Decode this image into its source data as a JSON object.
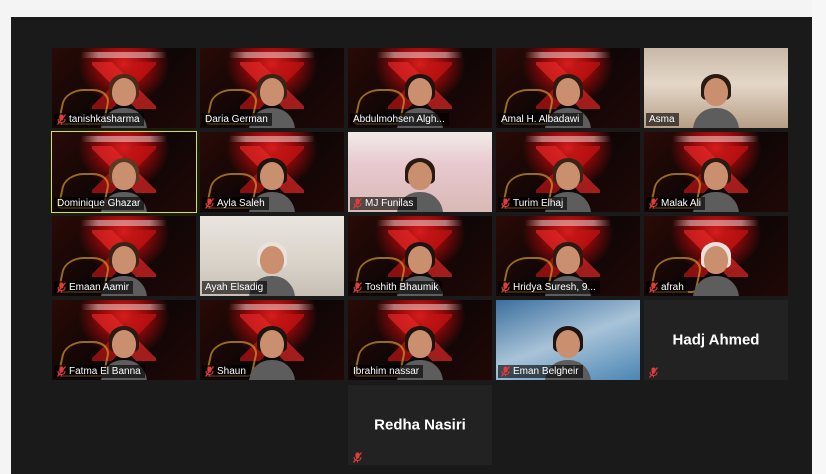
{
  "colors": {
    "active_border": "#cfe34a",
    "muted_mic": "#e23b3b",
    "background": "#1a1a1a"
  },
  "icons": {
    "muted": "mic-muted-icon"
  },
  "participants": [
    {
      "name": "tanishkasharma",
      "muted": true
    },
    {
      "name": "Daria German",
      "muted": false
    },
    {
      "name": "Abdulmohsen Algh...",
      "muted": false
    },
    {
      "name": "Amal H. Albadawi",
      "muted": false
    },
    {
      "name": "Asma",
      "muted": false
    },
    {
      "name": "Dominique Ghazar",
      "muted": false,
      "active_speaker": true
    },
    {
      "name": "Ayla Saleh",
      "muted": true
    },
    {
      "name": "MJ Funilas",
      "muted": true
    },
    {
      "name": "Turim Elhaj",
      "muted": true
    },
    {
      "name": "Malak Ali",
      "muted": true
    },
    {
      "name": "Emaan Aamir",
      "muted": true
    },
    {
      "name": "Ayah Elsadig",
      "muted": false
    },
    {
      "name": "Toshith Bhaumik",
      "muted": true
    },
    {
      "name": "Hridya Suresh, 9...",
      "muted": true
    },
    {
      "name": "afrah",
      "muted": true
    },
    {
      "name": "Fatma El Banna",
      "muted": true
    },
    {
      "name": "Shaun",
      "muted": true
    },
    {
      "name": "Ibrahim nassar",
      "muted": false
    },
    {
      "name": "Eman Belgheir",
      "muted": true
    },
    {
      "name": "Hadj Ahmed",
      "muted": true,
      "video_off": true
    },
    {
      "name": "Redha Nasiri",
      "muted": true,
      "video_off": true
    }
  ]
}
